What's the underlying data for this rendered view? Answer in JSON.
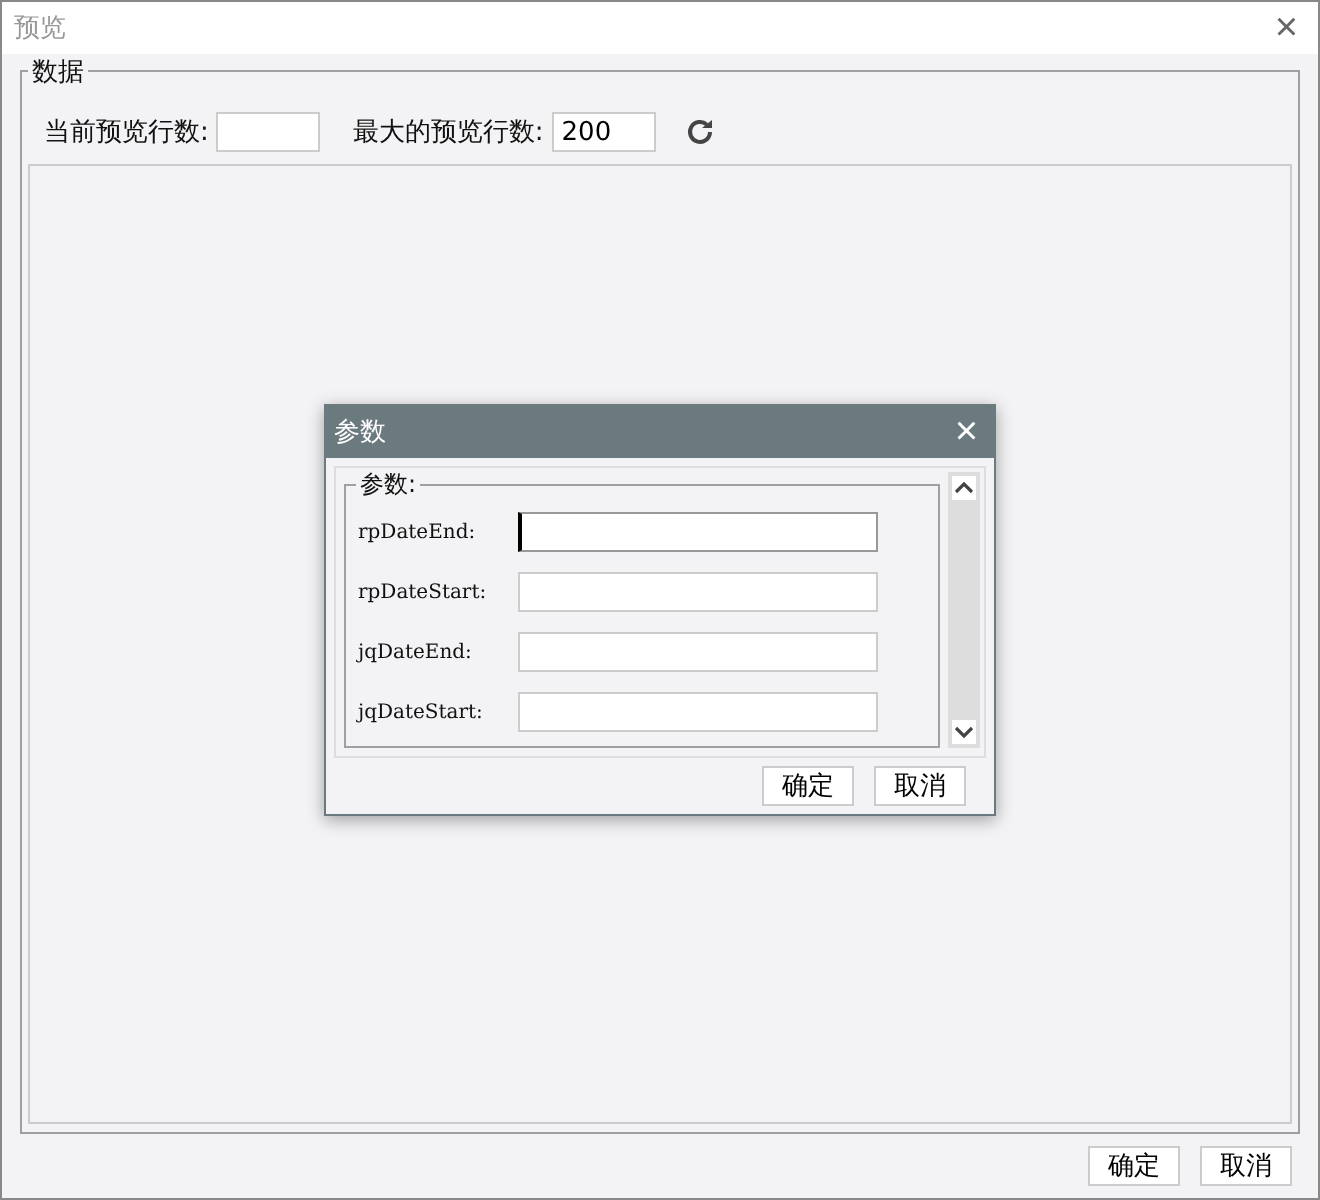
{
  "window": {
    "title": "预览",
    "close": "×"
  },
  "group": {
    "title": "数据",
    "current_label": "当前预览行数:",
    "max_label": "最大的预览行数:",
    "max_value": "200"
  },
  "dialog": {
    "title": "参数",
    "close": "×",
    "group_title": "参数:",
    "fields": [
      {
        "label": "rpDateEnd:",
        "focused": true
      },
      {
        "label": "rpDateStart:",
        "focused": false
      },
      {
        "label": "jqDateEnd:",
        "focused": false
      },
      {
        "label": "jqDateStart:",
        "focused": false
      }
    ],
    "buttons": [
      "确定",
      "取消"
    ]
  },
  "buttons": [
    "确定",
    "取消"
  ]
}
